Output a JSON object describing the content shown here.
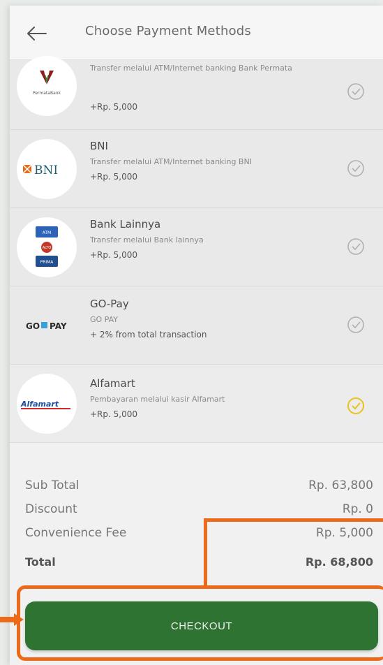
{
  "header": {
    "title": "Choose Payment Methods"
  },
  "methods": [
    {
      "logo": "PermataBank",
      "name": "",
      "desc": "Transfer melalui ATM/Internet banking Bank Permata",
      "fee": "+Rp. 5,000",
      "selected": false
    },
    {
      "logo": "BNI",
      "name": "BNI",
      "desc": "Transfer melalui ATM/Internet banking BNI",
      "fee": "+Rp. 5,000",
      "selected": false
    },
    {
      "logo": "ATM BERSAMA / ALTO / PRIMA",
      "name": "Bank Lainnya",
      "desc": "Transfer melalui Bank lainnya",
      "fee": "+Rp. 5,000",
      "selected": false
    },
    {
      "logo": "GOPAY",
      "name": "GO-Pay",
      "desc": "GO PAY",
      "fee": "+ 2% from total transaction",
      "selected": false
    },
    {
      "logo": "Alfamart",
      "name": "Alfamart",
      "desc": "Pembayaran melalui kasir Alfamart",
      "fee": "+Rp. 5,000",
      "selected": true
    }
  ],
  "summary": {
    "subtotal_label": "Sub Total",
    "subtotal": "Rp. 63,800",
    "discount_label": "Discount",
    "discount": "Rp. 0",
    "fee_label": "Convenience Fee",
    "fee": "Rp. 5,000",
    "total_label": "Total",
    "total": "Rp. 68,800"
  },
  "checkout_label": "CHECKOUT",
  "colors": {
    "accent": "#2f7333",
    "highlight": "#ee6a1b",
    "selected_check": "#e8c31a"
  }
}
